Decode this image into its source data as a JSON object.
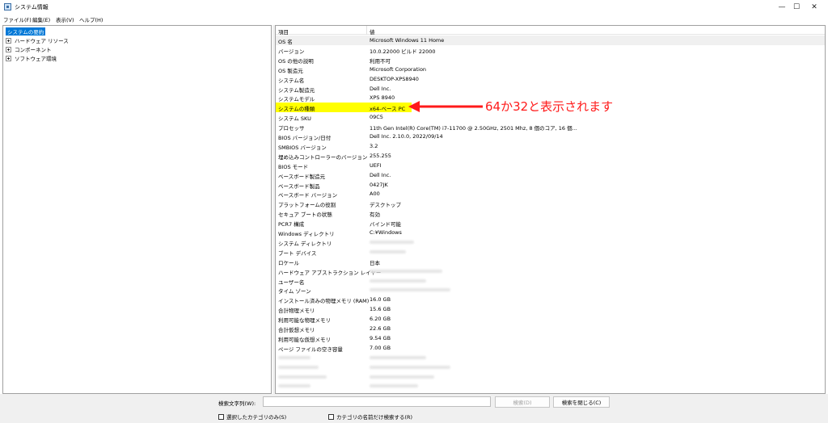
{
  "window": {
    "title": "システム情報",
    "minimize": "—",
    "maximize": "☐",
    "close": "✕"
  },
  "menu": [
    "ファイル(F)",
    "編集(E)",
    "表示(V)",
    "ヘルプ(H)"
  ],
  "tree": [
    {
      "label": "システムの要約",
      "selected": true,
      "expandable": false
    },
    {
      "label": "ハードウェア リソース",
      "selected": false,
      "expandable": true
    },
    {
      "label": "コンポーネント",
      "selected": false,
      "expandable": true
    },
    {
      "label": "ソフトウェア環境",
      "selected": false,
      "expandable": true
    }
  ],
  "list": {
    "header_item": "項目",
    "header_value": "値",
    "rows": [
      {
        "item": "OS 名",
        "value": "Microsoft Windows 11 Home"
      },
      {
        "item": "バージョン",
        "value": "10.0.22000 ビルド 22000"
      },
      {
        "item": "OS の他の説明",
        "value": "利用不可"
      },
      {
        "item": "OS 製造元",
        "value": "Microsoft Corporation"
      },
      {
        "item": "システム名",
        "value": "DESKTOP-XPS8940"
      },
      {
        "item": "システム製造元",
        "value": "Dell Inc."
      },
      {
        "item": "システムモデル",
        "value": "XPS 8940"
      },
      {
        "item": "システムの種類",
        "value": "x64-ベース PC",
        "highlight": true
      },
      {
        "item": "システム SKU",
        "value": "09C5"
      },
      {
        "item": "プロセッサ",
        "value": "11th Gen Intel(R) Core(TM) i7-11700 @ 2.50GHz, 2501 Mhz, 8 個のコア, 16 個..."
      },
      {
        "item": "BIOS バージョン/日付",
        "value": "Dell Inc. 2.10.0, 2022/09/14"
      },
      {
        "item": "SMBIOS バージョン",
        "value": "3.2"
      },
      {
        "item": "埋め込みコントローラーのバージョン",
        "value": "255.255"
      },
      {
        "item": "BIOS モード",
        "value": "UEFI"
      },
      {
        "item": "ベースボード製造元",
        "value": "Dell Inc."
      },
      {
        "item": "ベースボード製品",
        "value": "0427JK"
      },
      {
        "item": "ベースボード バージョン",
        "value": "A00"
      },
      {
        "item": "プラットフォームの役割",
        "value": "デスクトップ"
      },
      {
        "item": "セキュア ブートの状態",
        "value": "有効"
      },
      {
        "item": "PCR7 構成",
        "value": "バインド可能"
      },
      {
        "item": "Windows ディレクトリ",
        "value": "C:¥Windows"
      },
      {
        "item": "システム ディレクトリ",
        "value": "",
        "blurred": true
      },
      {
        "item": "ブート デバイス",
        "value": "",
        "blurred": true
      },
      {
        "item": "ロケール",
        "value": "日本"
      },
      {
        "item": "ハードウェア アブストラクション レイヤー",
        "value": "",
        "blurred": true
      },
      {
        "item": "ユーザー名",
        "value": "",
        "blurred": true
      },
      {
        "item": "タイム ゾーン",
        "value": "",
        "blurred": true
      },
      {
        "item": "インストール済みの物理メモリ (RAM)",
        "value": "16.0 GB"
      },
      {
        "item": "合計物理メモリ",
        "value": "15.6 GB"
      },
      {
        "item": "利用可能な物理メモリ",
        "value": "6.20 GB"
      },
      {
        "item": "合計仮想メモリ",
        "value": "22.6 GB"
      },
      {
        "item": "利用可能な仮想メモリ",
        "value": "9.54 GB"
      },
      {
        "item": "ページ ファイルの空き容量",
        "value": "7.00 GB"
      },
      {
        "item": "",
        "value": "",
        "blurred": true,
        "blurred_item": true
      },
      {
        "item": "",
        "value": "",
        "blurred": true,
        "blurred_item": true
      },
      {
        "item": "",
        "value": "",
        "blurred": true,
        "blurred_item": true
      },
      {
        "item": "",
        "value": "",
        "blurred": true,
        "blurred_item": true
      }
    ]
  },
  "annotation": {
    "text": "64か32と表示されます",
    "color": "#ff1a1a"
  },
  "search": {
    "label": "検索文字列(W):",
    "value": "",
    "find_button": "検索(D)",
    "close_find_button": "検索を閉じる(C)",
    "checkbox_selected": "選択したカテゴリのみ(S)",
    "checkbox_names": "カテゴリの名前だけ検索する(R)"
  },
  "colors": {
    "selection": "#0078d7",
    "highlight": "#ffff00"
  }
}
